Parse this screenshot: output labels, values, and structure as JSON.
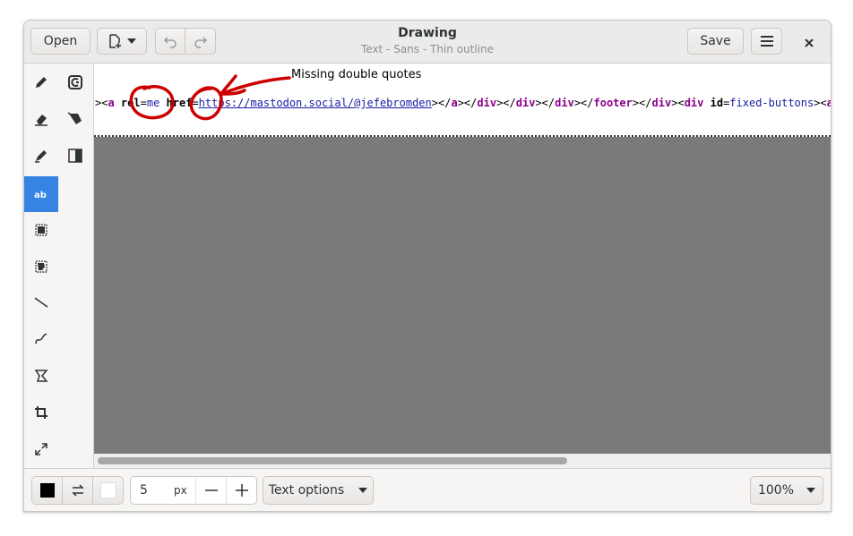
{
  "header": {
    "open_label": "Open",
    "title": "Drawing",
    "subtitle": "Text - Sans - Thin outline",
    "save_label": "Save"
  },
  "tools": [
    {
      "name": "pencil-icon"
    },
    {
      "name": "color-picker-icon"
    },
    {
      "name": "eraser-icon"
    },
    {
      "name": "paint-bucket-icon"
    },
    {
      "name": "highlighter-icon"
    },
    {
      "name": "filter-icon"
    },
    {
      "name": "text-tool-icon",
      "active": true
    },
    {
      "name": "rectangle-selection-icon"
    },
    {
      "name": "free-selection-icon"
    },
    {
      "name": "line-icon"
    },
    {
      "name": "curve-icon"
    },
    {
      "name": "shape-icon"
    },
    {
      "name": "crop-icon"
    },
    {
      "name": "scale-icon"
    }
  ],
  "canvas": {
    "annotation": "Missing double quotes",
    "code": {
      "p1": "><",
      "p2": "a",
      "p3": " ",
      "p4": "rel",
      "p5": "=",
      "p6": "me",
      "p7": " ",
      "p8": "href",
      "p9": "=",
      "p10": "https://mastodon.social/@jefebromden",
      "p11": "></",
      "p12": "a",
      "p13": "></",
      "p14": "div",
      "p15": "></",
      "p16": "div",
      "p17": "></",
      "p18": "div",
      "p19": "></",
      "p20": "footer",
      "p21": "></",
      "p22": "div",
      "p23": "><",
      "p24": "div",
      "p25": " ",
      "p26": "id",
      "p27": "=",
      "p28": "fixed-buttons",
      "p29": "><",
      "p30": "a"
    },
    "ink_color": "#cc0000"
  },
  "bottom": {
    "size_value": "5",
    "size_unit": "px",
    "text_options_label": "Text options",
    "zoom_label": "100%"
  },
  "colors": {
    "accent": "#3584e4",
    "main_color": "#000000",
    "secondary_color": "#ffffff"
  }
}
